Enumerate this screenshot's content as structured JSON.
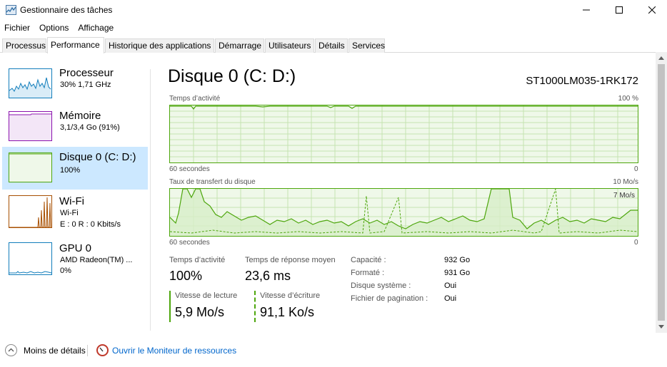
{
  "window": {
    "title": "Gestionnaire des tâches"
  },
  "menu": [
    "Fichier",
    "Options",
    "Affichage"
  ],
  "tabs": [
    "Processus",
    "Performance",
    "Historique des applications",
    "Démarrage",
    "Utilisateurs",
    "Détails",
    "Services"
  ],
  "active_tab": "Performance",
  "sidebar": [
    {
      "title": "Processeur",
      "sub1": "30%  1,71 GHz",
      "sub2": "",
      "color": "#117dbb"
    },
    {
      "title": "Mémoire",
      "sub1": "3,1/3,4 Go (91%)",
      "sub2": "",
      "color": "#8b12ae"
    },
    {
      "title": "Disque 0 (C: D:)",
      "sub1": "100%",
      "sub2": "",
      "color": "#4da60c",
      "selected": true
    },
    {
      "title": "Wi-Fi",
      "sub1": "Wi-Fi",
      "sub2": "E : 0  R : 0 Kbits/s",
      "color": "#a74f01"
    },
    {
      "title": "GPU 0",
      "sub1": "AMD Radeon(TM) ...",
      "sub2": "0%",
      "color": "#117dbb"
    }
  ],
  "main": {
    "title": "Disque 0 (C: D:)",
    "model": "ST1000LM035-1RK172",
    "graph1": {
      "label": "Temps d’activité",
      "max_label": "100 %",
      "time_label": "60 secondes",
      "min_label": "0"
    },
    "graph2": {
      "label": "Taux de transfert du disque",
      "max_label": "10 Mo/s",
      "secondary_label": "7 Mo/s",
      "time_label": "60 secondes",
      "min_label": "0"
    },
    "stats": {
      "active_time_label": "Temps d’activité",
      "active_time_value": "100%",
      "response_label": "Temps de réponse moyen",
      "response_value": "23,6 ms",
      "read_label": "Vitesse de lecture",
      "read_value": "5,9 Mo/s",
      "write_label": "Vitesse d’écriture",
      "write_value": "91,1 Ko/s"
    },
    "properties": [
      {
        "label": "Capacité :",
        "value": "932 Go"
      },
      {
        "label": "Formaté :",
        "value": "931 Go"
      },
      {
        "label": "Disque système :",
        "value": "Oui"
      },
      {
        "label": "Fichier de pagination :",
        "value": "Oui"
      }
    ]
  },
  "footer": {
    "less_details": "Moins de détails",
    "resource_monitor": "Ouvrir le Moniteur de ressources"
  },
  "colors": {
    "accent": "#4da60c",
    "selection": "#cce8ff",
    "link": "#0066cc"
  }
}
